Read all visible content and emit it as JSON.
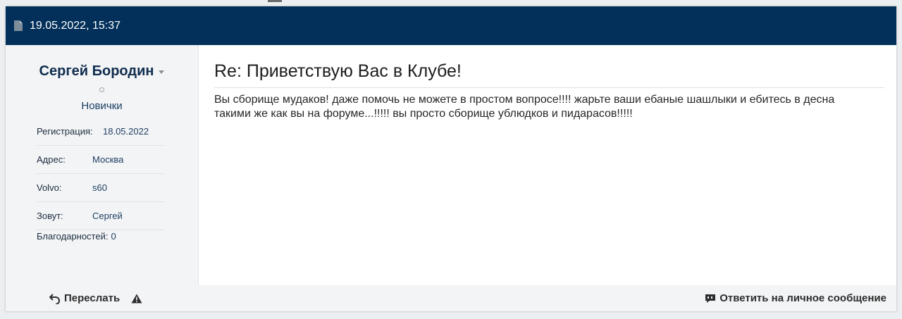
{
  "post": {
    "date": "19.05.2022, 15:37",
    "title": "Re: Приветствую Вас в Клубе!",
    "text": "Вы сборище мудаков! даже помочь не можете в простом вопросе!!!! жарьте ваши ебаные шашлыки и ебитесь в десна такими же как вы на форуме...!!!!! вы просто сборище ублюдков и пидарасов!!!!!"
  },
  "author": {
    "name": "Сергей Бородин",
    "rank": "Новички",
    "details": [
      {
        "label": "Регистрация:",
        "value": "18.05.2022"
      },
      {
        "label": "Адрес:",
        "value": "Москва"
      },
      {
        "label": "Volvo:",
        "value": "s60"
      },
      {
        "label": "Зовут:",
        "value": "Сергей"
      },
      {
        "label": "Благодарностей:",
        "value": "0"
      }
    ]
  },
  "footer": {
    "forward_label": "Переслать",
    "reply_private_label": "Ответить на личное сообщение"
  },
  "colors": {
    "header_bg": "#03305a",
    "author_name": "#0f2d4e",
    "panel_bg": "#f3f4f6"
  },
  "icons": {
    "header": "document-icon",
    "author_menu": "caret-down-icon",
    "status": "offline-status-icon",
    "forward": "undo-arrow-icon",
    "report": "warning-triangle-icon",
    "reply": "chat-bubble-icon"
  }
}
